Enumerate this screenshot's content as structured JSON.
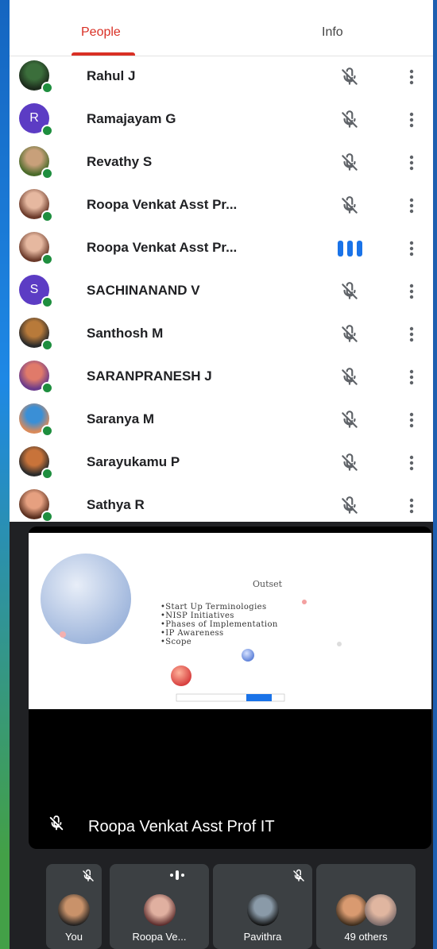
{
  "tabs": {
    "people": "People",
    "info": "Info"
  },
  "participants": [
    {
      "name": "Rahul J",
      "avatar": "photo",
      "mic": "muted"
    },
    {
      "name": "Ramajayam G",
      "avatar": "letter",
      "initial": "R",
      "mic": "muted"
    },
    {
      "name": "Revathy S",
      "avatar": "photo",
      "mic": "muted"
    },
    {
      "name": "Roopa Venkat Asst Pr...",
      "avatar": "photo",
      "mic": "muted"
    },
    {
      "name": "Roopa Venkat Asst Pr...",
      "avatar": "photo",
      "mic": "speaking"
    },
    {
      "name": "SACHINANAND V",
      "avatar": "letter",
      "initial": "S",
      "mic": "muted"
    },
    {
      "name": "Santhosh M",
      "avatar": "photo",
      "mic": "muted"
    },
    {
      "name": "SARANPRANESH J",
      "avatar": "photo",
      "mic": "muted"
    },
    {
      "name": "Saranya M",
      "avatar": "photo",
      "mic": "muted"
    },
    {
      "name": "Sarayukamu P",
      "avatar": "photo",
      "mic": "muted"
    },
    {
      "name": "Sathya R",
      "avatar": "photo",
      "mic": "muted"
    }
  ],
  "slide": {
    "title": "Outset",
    "bullets": [
      "•Start Up Terminologies",
      "•NISP Initiatives",
      "•Phases of Implementation",
      "•IP Awareness",
      "•Scope"
    ]
  },
  "presenter": {
    "name": "Roopa Venkat Asst Prof IT"
  },
  "thumbnails": [
    {
      "label": "You",
      "mic": "muted"
    },
    {
      "label": "Roopa Ve...",
      "mic": "speaking"
    },
    {
      "label": "Pavithra",
      "mic": "muted"
    },
    {
      "label": "49 others"
    }
  ],
  "colors": {
    "accent": "#d93025",
    "online": "#1e8e3e",
    "speaking": "#1a73e8",
    "letter_avatar": "#5c3cc4"
  }
}
